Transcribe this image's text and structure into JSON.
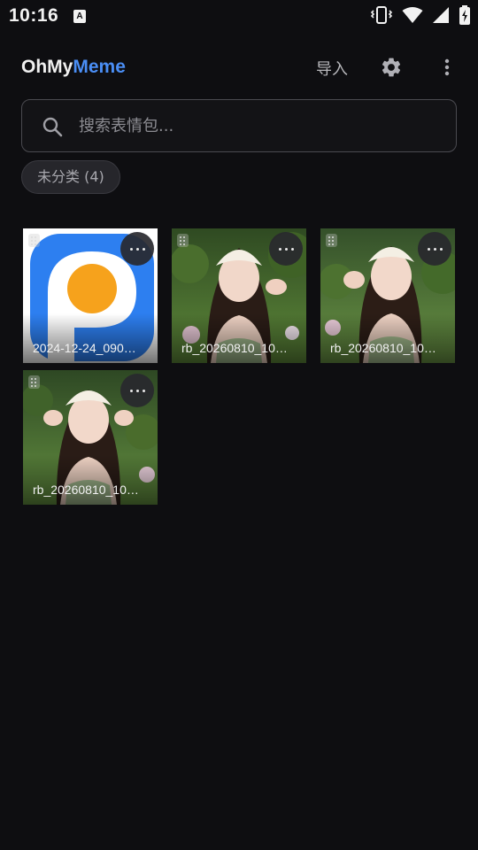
{
  "status_bar": {
    "time": "10:16",
    "notification_badge": "A",
    "icons": [
      "vibrate-icon",
      "wifi-icon",
      "signal-icon",
      "battery-charging-icon"
    ]
  },
  "app_bar": {
    "brand_part1": "OhMy",
    "brand_part2": "Meme",
    "import_label": "导入",
    "settings_icon": "gear-icon",
    "more_icon": "more-vert-icon",
    "brand_accent_color": "#4a8ef5"
  },
  "search": {
    "placeholder": "搜索表情包...",
    "value": ""
  },
  "category_chip": {
    "label": "未分类 (4)"
  },
  "memes": [
    {
      "label": "2024-12-24_090…",
      "kind": "logo"
    },
    {
      "label": "rb_20260810_10…",
      "kind": "photo"
    },
    {
      "label": "rb_20260810_10…",
      "kind": "photo"
    },
    {
      "label": "rb_20260810_10…",
      "kind": "photo"
    }
  ]
}
